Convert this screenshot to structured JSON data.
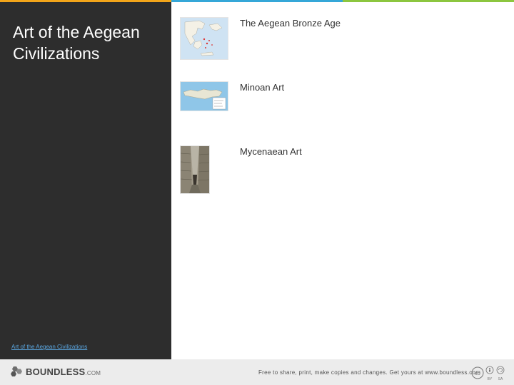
{
  "theme": {
    "stripe_colors": [
      "#f2a51a",
      "#35a7d8",
      "#8cc63f"
    ],
    "sidebar_bg": "#2d2d2d",
    "link_color": "#5aa6e0"
  },
  "sidebar": {
    "title": "Art of the Aegean\nCivilizations",
    "link": "Art of the Aegean Civilizations"
  },
  "items": [
    {
      "label": "The Aegean Bronze Age",
      "thumb_icon": "greece-map-thumbnail"
    },
    {
      "label": "Minoan Art",
      "thumb_icon": "crete-map-thumbnail"
    },
    {
      "label": "Mycenaean Art",
      "thumb_icon": "stone-corridor-photo-thumbnail"
    }
  ],
  "footer": {
    "brand": "BOUNDLESS",
    "brand_suffix": ".COM",
    "notice": "Free to share, print, make copies and changes. Get yours at www.boundless.com",
    "license_labels": [
      "BY",
      "SA"
    ]
  }
}
